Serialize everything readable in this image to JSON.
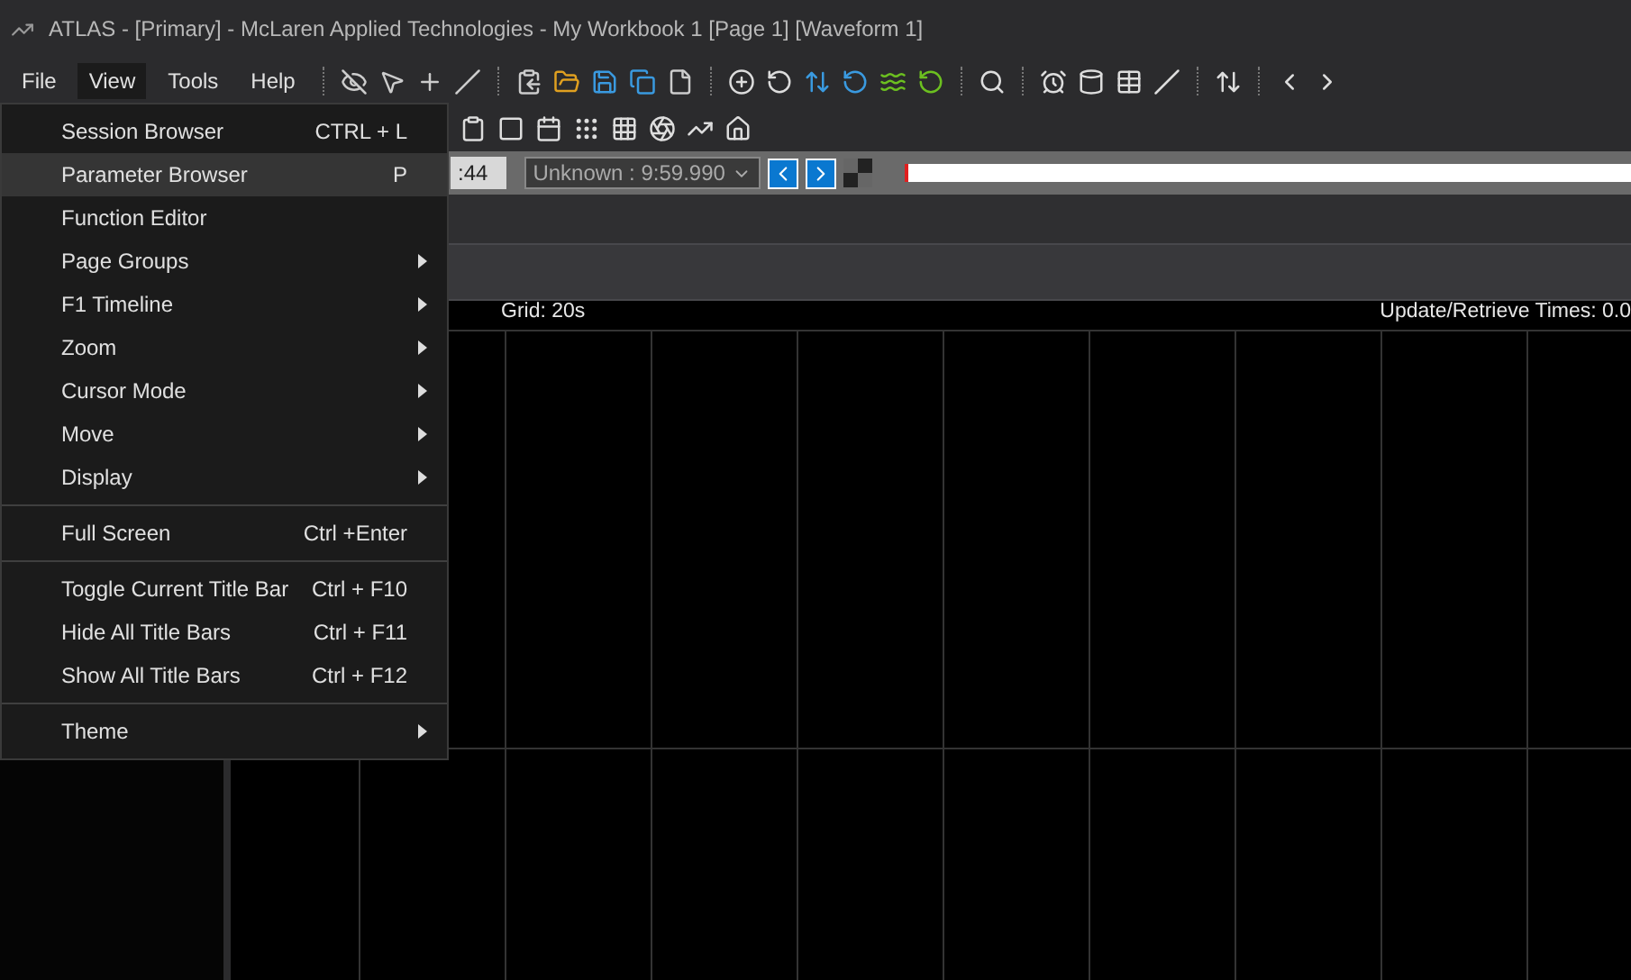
{
  "window": {
    "title": "ATLAS - [Primary] - McLaren Applied Technologies - My Workbook 1 [Page 1] [Waveform 1]"
  },
  "menubar": [
    {
      "label": "File",
      "selected": false
    },
    {
      "label": "View",
      "selected": true
    },
    {
      "label": "Tools",
      "selected": false
    },
    {
      "label": "Help",
      "selected": false
    }
  ],
  "view_menu": {
    "groups": [
      [
        {
          "label": "Session Browser",
          "shortcut": "CTRL + L",
          "submenu": false,
          "selected": false
        },
        {
          "label": "Parameter Browser",
          "shortcut": "P",
          "submenu": false,
          "selected": true
        },
        {
          "label": "Function Editor",
          "submenu": false,
          "selected": false
        },
        {
          "label": "Page Groups",
          "submenu": true,
          "selected": false
        },
        {
          "label": "F1 Timeline",
          "submenu": true,
          "selected": false
        },
        {
          "label": "Zoom",
          "submenu": true,
          "selected": false
        },
        {
          "label": "Cursor Mode",
          "submenu": true,
          "selected": false
        },
        {
          "label": "Move",
          "submenu": true,
          "selected": false
        },
        {
          "label": "Display",
          "submenu": true,
          "selected": false
        }
      ],
      [
        {
          "label": "Full Screen",
          "shortcut": "Ctrl +Enter",
          "submenu": false,
          "selected": false
        }
      ],
      [
        {
          "label": "Toggle Current Title Bar",
          "shortcut": "Ctrl + F10",
          "submenu": false,
          "selected": false
        },
        {
          "label": "Hide All Title Bars",
          "shortcut": "Ctrl + F11",
          "submenu": false,
          "selected": false
        },
        {
          "label": "Show All Title Bars",
          "shortcut": "Ctrl + F12",
          "submenu": false,
          "selected": false
        }
      ],
      [
        {
          "label": "Theme",
          "submenu": true,
          "selected": false
        }
      ]
    ]
  },
  "time_bar": {
    "time": ":44",
    "session": "Unknown : 9:59.990",
    "progress": {
      "level": 1
    }
  },
  "waveform": {
    "grid_label": "Grid: 20s",
    "times_label": "Update/Retrieve Times: 0.0"
  }
}
